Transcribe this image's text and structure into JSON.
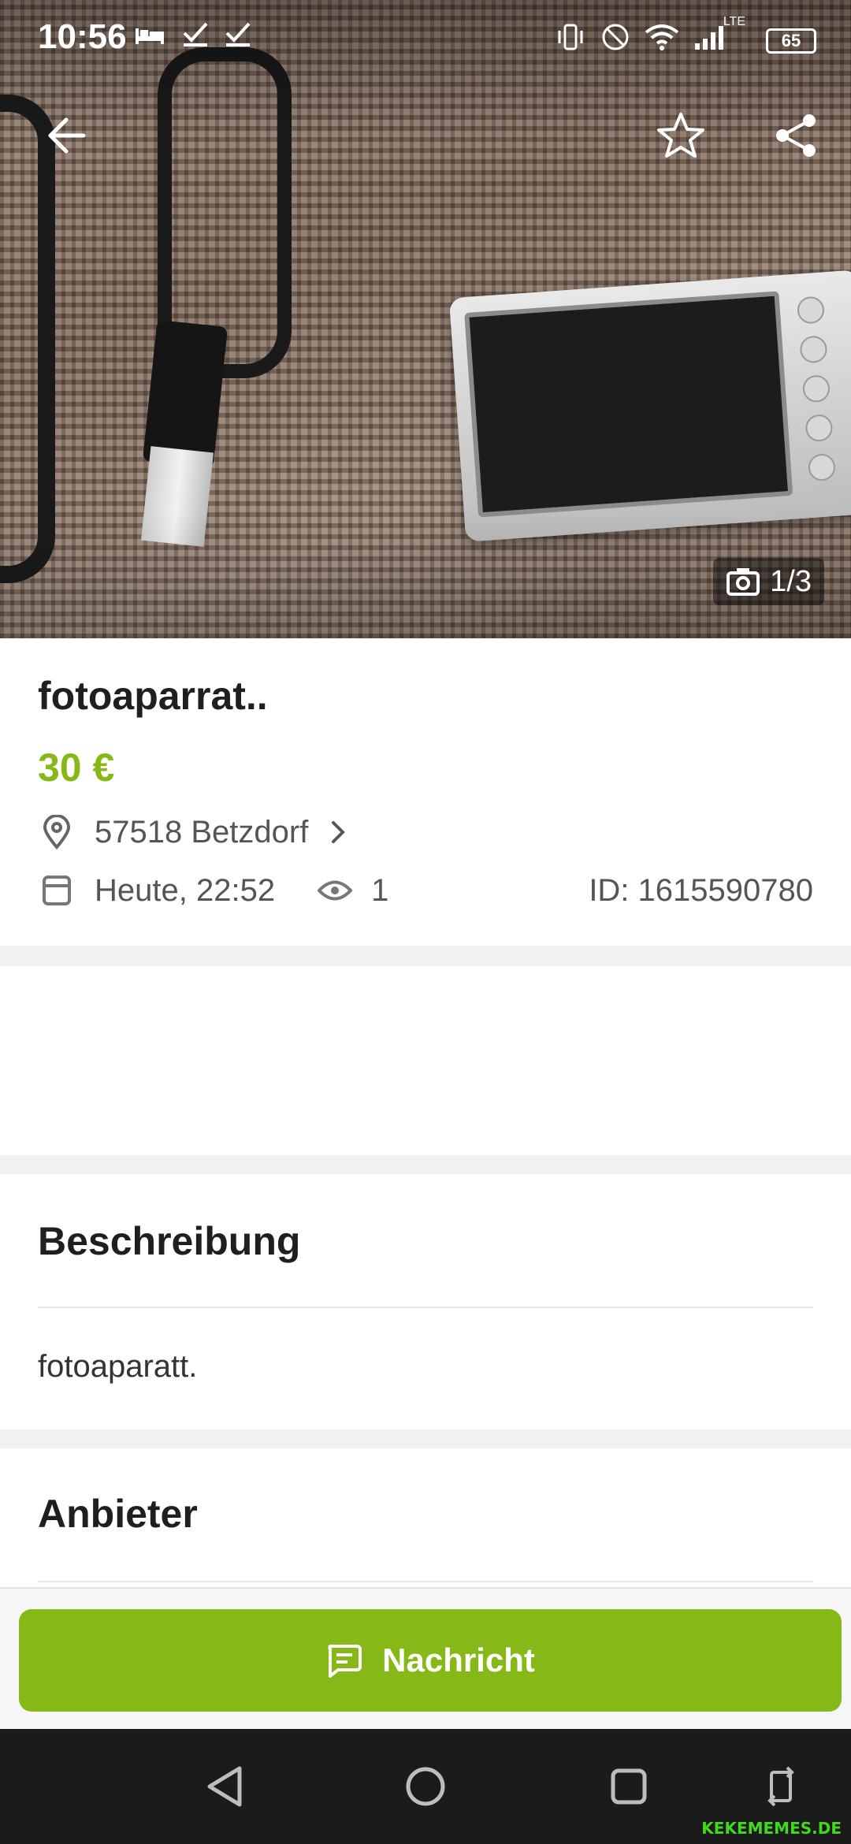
{
  "status_bar": {
    "time": "10:56",
    "left_icons": [
      "bed-icon",
      "check-icon",
      "check-icon"
    ],
    "network": "LTE",
    "battery": "65"
  },
  "gallery": {
    "counter": "1/3"
  },
  "listing": {
    "title": "fotoaparrat..",
    "price": "30 €",
    "location": "57518 Betzdorf",
    "date": "Heute, 22:52",
    "views": "1",
    "id_label": "ID: 1615590780"
  },
  "description": {
    "heading": "Beschreibung",
    "text": "fotoaparatt."
  },
  "seller": {
    "heading": "Anbieter"
  },
  "actions": {
    "message_label": "Nachricht"
  },
  "watermark": "KEKEMEMES.DE",
  "colors": {
    "accent": "#86b817",
    "text": "#1f1f1f",
    "muted": "#555555"
  }
}
